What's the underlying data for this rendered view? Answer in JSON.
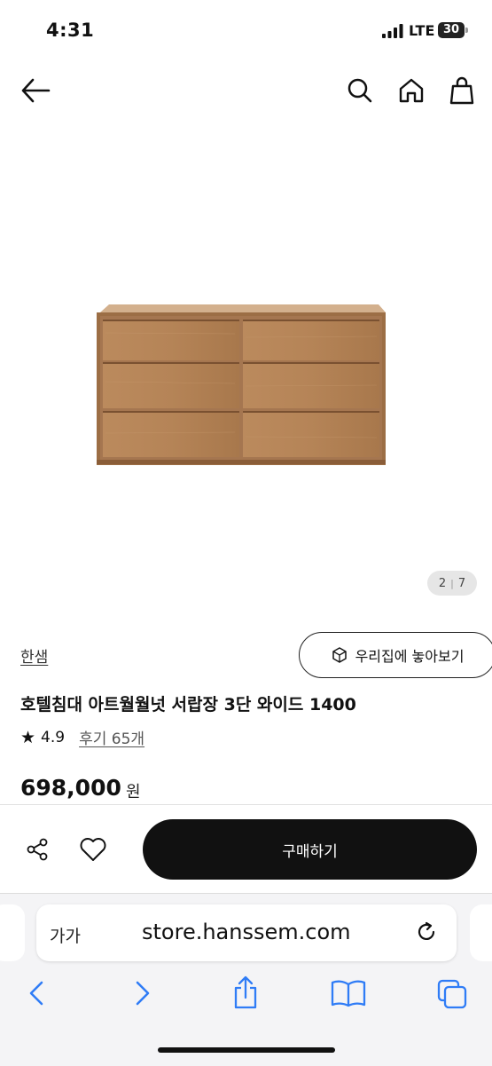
{
  "status": {
    "time": "4:31",
    "network": "LTE",
    "battery": "30"
  },
  "header": {
    "back_icon": "arrow-left-icon",
    "search_icon": "search-icon",
    "home_icon": "home-icon",
    "cart_icon": "shopping-bag-icon"
  },
  "gallery": {
    "current": "2",
    "separator": "|",
    "total": "7"
  },
  "product": {
    "brand": "한샘",
    "ar_label": "우리집에 놓아보기",
    "title": "호텔침대 아트월월넛 서랍장 3단 와이드 1400",
    "rating_star": "★",
    "rating": "4.9",
    "reviews": "후기 65개",
    "price": "698,000",
    "price_unit": "원"
  },
  "actions": {
    "buy_label": "구매하기",
    "share_icon": "share-icon",
    "heart_icon": "heart-icon"
  },
  "browser": {
    "text_size_label": "가가",
    "url": "store.hanssem.com",
    "reload_icon": "reload-icon",
    "nav_icons": [
      "back-icon",
      "forward-icon",
      "share-icon",
      "bookmarks-icon",
      "tabs-icon"
    ]
  },
  "colors": {
    "accent": "#111111",
    "wood": "#b07f52",
    "wood_dark": "#8a5d38"
  }
}
